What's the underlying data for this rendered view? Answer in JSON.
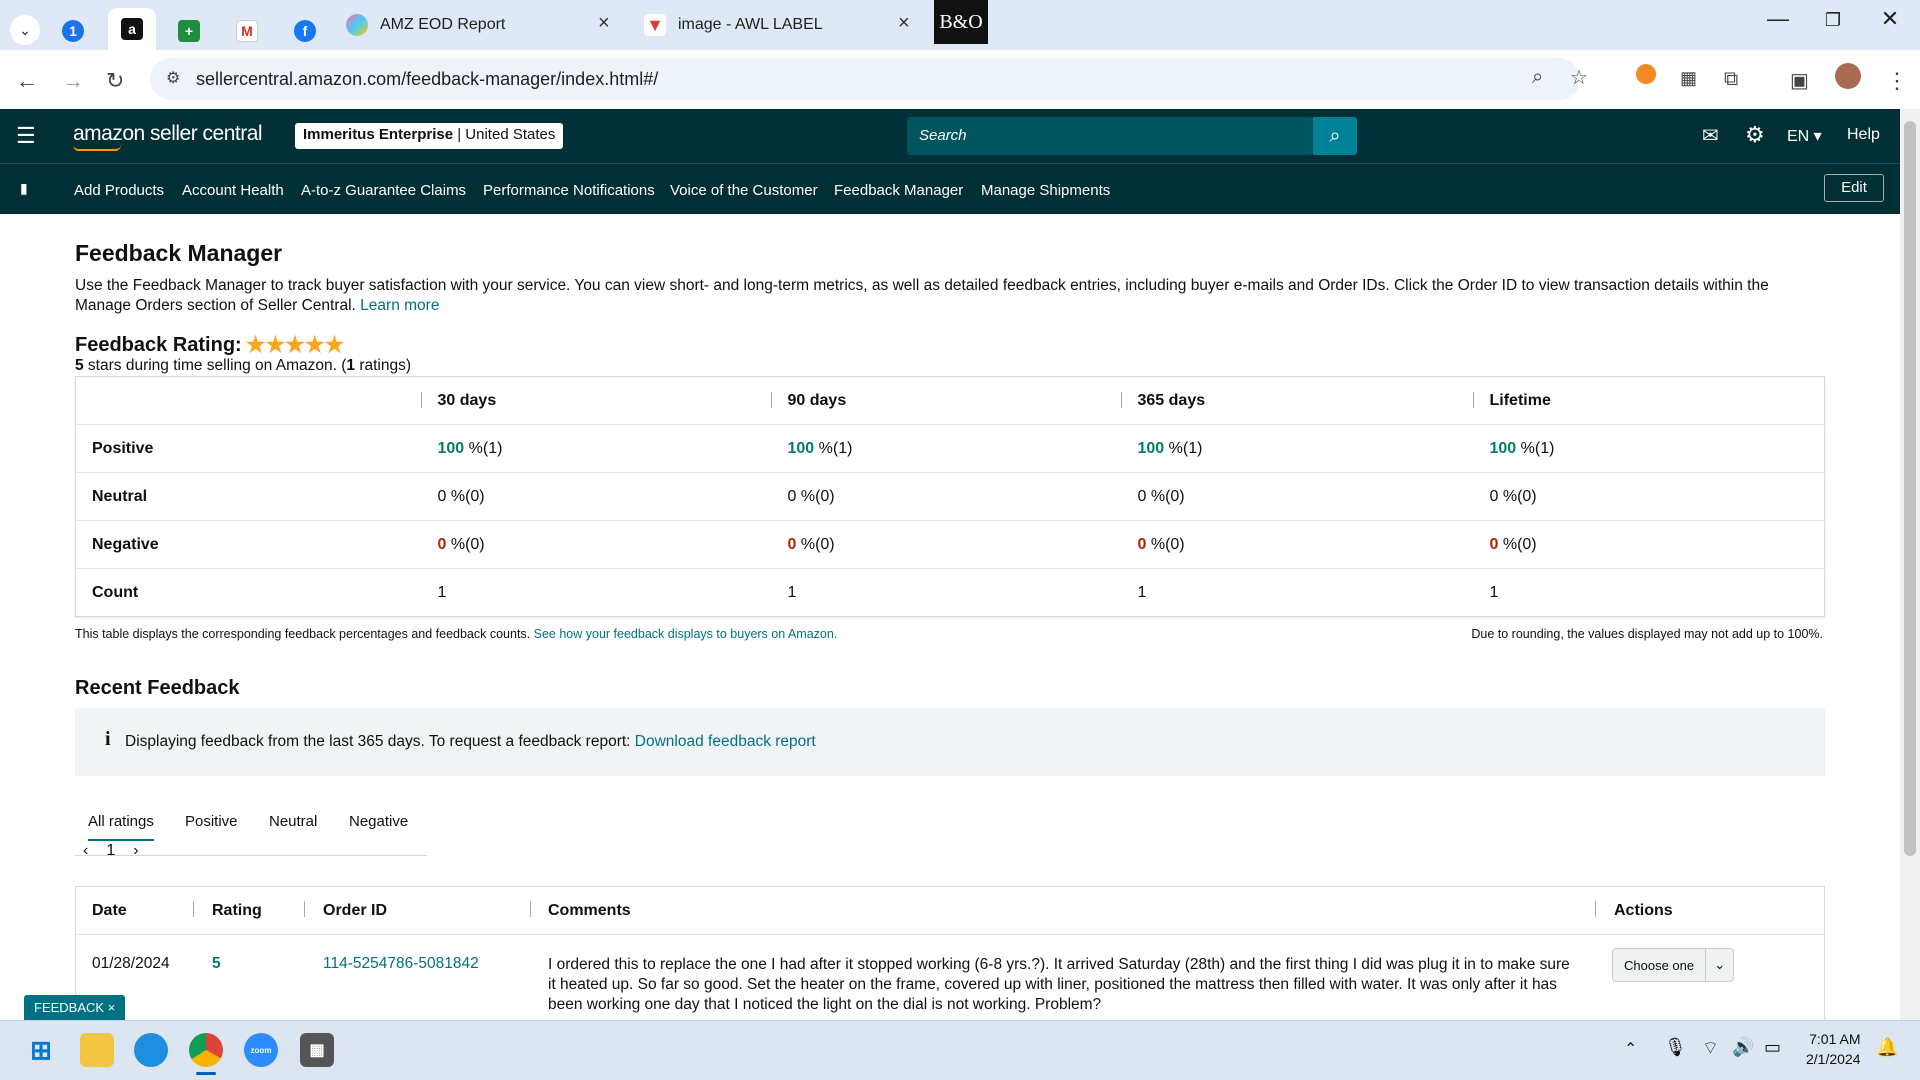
{
  "browser": {
    "tabs": [
      {
        "title": "",
        "icon": "1password-icon"
      },
      {
        "title": "",
        "icon": "amazon-icon"
      },
      {
        "title": "",
        "icon": "sheets-icon"
      },
      {
        "title": "",
        "icon": "gmail-icon"
      },
      {
        "title": "",
        "icon": "facebook-icon"
      },
      {
        "title": "AMZ EOD Report",
        "icon": "clickup-icon"
      },
      {
        "title": "image - AWL LABEL",
        "icon": "todoist-icon"
      },
      {
        "title": "B&O",
        "icon": "bo-icon"
      }
    ],
    "url": "sellercentral.amazon.com/feedback-manager/index.html#/"
  },
  "header": {
    "logo": "amazon seller central",
    "account_name": "Immeritus Enterprise",
    "account_region": "United States",
    "search_placeholder": "Search",
    "lang": "EN",
    "help": "Help"
  },
  "nav": {
    "items": [
      "Add Products",
      "Account Health",
      "A-to-z Guarantee Claims",
      "Performance Notifications",
      "Voice of the Customer",
      "Feedback Manager",
      "Manage Shipments"
    ],
    "edit": "Edit"
  },
  "page": {
    "title": "Feedback Manager",
    "intro": "Use the Feedback Manager to track buyer satisfaction with your service. You can view short- and long-term metrics, as well as detailed feedback entries, including buyer e-mails and Order IDs. Click the Order ID to view transaction details within the Manage Orders section of Seller Central.",
    "learn_more": "Learn more",
    "rating_label": "Feedback Rating:",
    "stars": 5,
    "rating_stars_value": "5",
    "rating_text_mid": " stars during time selling on Amazon. (",
    "rating_count": "1",
    "rating_text_end": " ratings)",
    "table_headers": [
      "30 days",
      "90 days",
      "365 days",
      "Lifetime"
    ],
    "rows": [
      {
        "label": "Positive",
        "cells": [
          {
            "v": "100",
            "s": " %(1)"
          },
          {
            "v": "100",
            "s": " %(1)"
          },
          {
            "v": "100",
            "s": " %(1)"
          },
          {
            "v": "100",
            "s": " %(1)"
          }
        ]
      },
      {
        "label": "Neutral",
        "cells": [
          {
            "v": "0",
            "s": " %(0)"
          },
          {
            "v": "0",
            "s": " %(0)"
          },
          {
            "v": "0",
            "s": " %(0)"
          },
          {
            "v": "0",
            "s": " %(0)"
          }
        ]
      },
      {
        "label": "Negative",
        "cells": [
          {
            "v": "0",
            "s": " %(0)"
          },
          {
            "v": "0",
            "s": " %(0)"
          },
          {
            "v": "0",
            "s": " %(0)"
          },
          {
            "v": "0",
            "s": " %(0)"
          }
        ]
      },
      {
        "label": "Count",
        "cells": [
          {
            "v": "1",
            "s": ""
          },
          {
            "v": "1",
            "s": ""
          },
          {
            "v": "1",
            "s": ""
          },
          {
            "v": "1",
            "s": ""
          }
        ]
      }
    ],
    "table_note": "This table displays the corresponding feedback percentages and feedback counts.",
    "table_note_link": "See how your feedback displays to buyers on Amazon.",
    "rounding_note": "Due to rounding, the values displayed may not add up to 100%.",
    "recent_title": "Recent Feedback",
    "info_text": "Displaying feedback from the last 365 days. To request a feedback report:",
    "info_link": "Download feedback report",
    "filter_tabs": [
      "All ratings",
      "Positive",
      "Neutral",
      "Negative"
    ],
    "page_num": "1",
    "recent_headers": [
      "Date",
      "Rating",
      "Order ID",
      "Comments",
      "Actions"
    ],
    "recent_row": {
      "date": "01/28/2024",
      "rating": "5",
      "order_id": "114-5254786-5081842",
      "comment": "I ordered this to replace the one I had after it stopped working (6-8 yrs.?). It arrived Saturday (28th) and the first thing I did was plug it in to make sure it heated up. So far so good. Set the heater on the frame, covered up with liner, positioned the mattress then filled with water. It was only after it has been working one day that I noticed the light on the dial is not working. Problem?",
      "action": "Choose one"
    },
    "feedback_tab": "FEEDBACK"
  },
  "taskbar": {
    "time": "7:01 AM",
    "date": "2/1/2024"
  },
  "colors": {
    "amz_dark": "#002f36",
    "search_btn": "#008296",
    "positive": "#067d62",
    "negative": "#b12704",
    "star": "#ffa41c"
  }
}
